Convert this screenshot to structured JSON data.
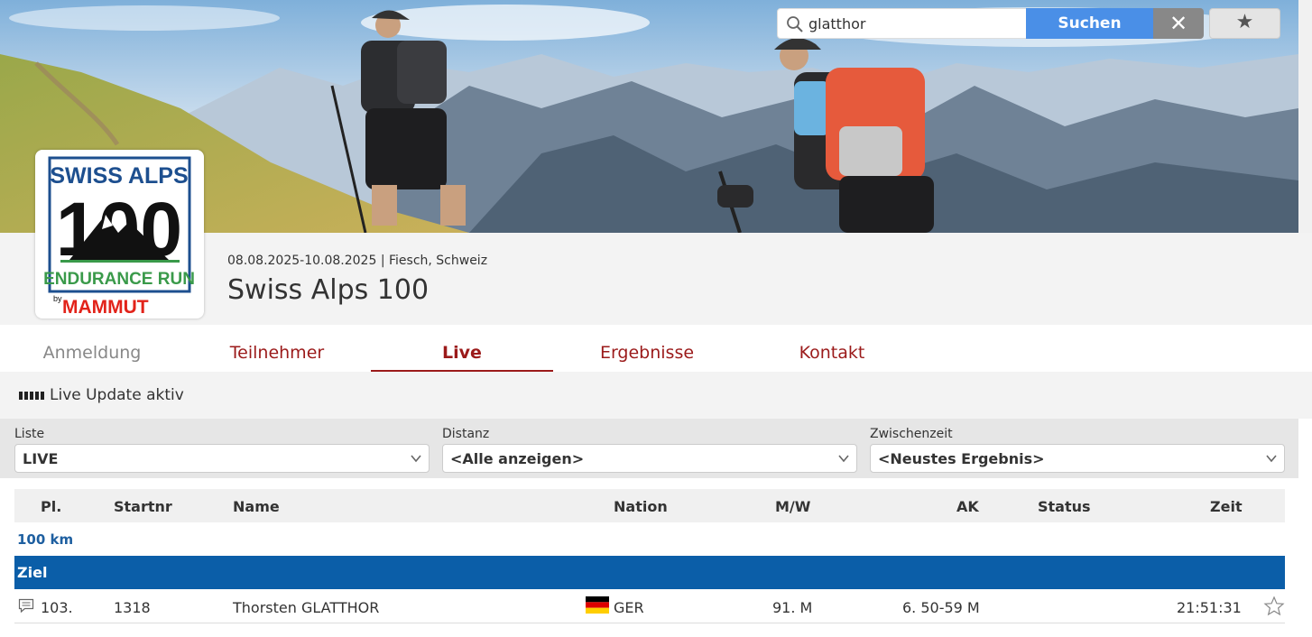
{
  "banner": {
    "logo_text_top": "SWISS ALPS",
    "logo_number": "100",
    "logo_text_bottom": "ENDURANCE RUN",
    "logo_by": "by",
    "logo_brand": "MAMMUT"
  },
  "event": {
    "date_location": "08.08.2025-10.08.2025 | Fiesch, Schweiz",
    "title": "Swiss Alps 100"
  },
  "tabs": [
    {
      "label": "Anmeldung"
    },
    {
      "label": "Teilnehmer"
    },
    {
      "label": "Live"
    },
    {
      "label": "Ergebnisse"
    },
    {
      "label": "Kontakt"
    }
  ],
  "toolbar": {
    "live_status": "Live Update aktiv",
    "search_value": "glatthor",
    "search_button": "Suchen",
    "clear_symbol": "✕",
    "favorite_symbol": "★"
  },
  "filters": [
    {
      "label": "Liste",
      "value": "LIVE"
    },
    {
      "label": "Distanz",
      "value": "<Alle anzeigen>"
    },
    {
      "label": "Zwischenzeit",
      "value": "<Neustes Ergebnis>"
    }
  ],
  "table": {
    "headers": {
      "place": "Pl.",
      "bib": "Startnr",
      "name": "Name",
      "nation": "Nation",
      "gender": "M/W",
      "age_group": "AK",
      "status": "Status",
      "time": "Zeit"
    },
    "group": "100 km",
    "subgroup": "Ziel",
    "rows": [
      {
        "place": "103.",
        "bib": "1318",
        "name": "Thorsten GLATTHOR",
        "nation": "GER",
        "gender": "91. M",
        "age_group": "6. 50-59 M",
        "status": "",
        "time": "21:51:31"
      }
    ]
  },
  "colors": {
    "accent_red": "#9b1a1a",
    "search_blue": "#4a8fe7",
    "group_blue": "#0b5ea8"
  }
}
